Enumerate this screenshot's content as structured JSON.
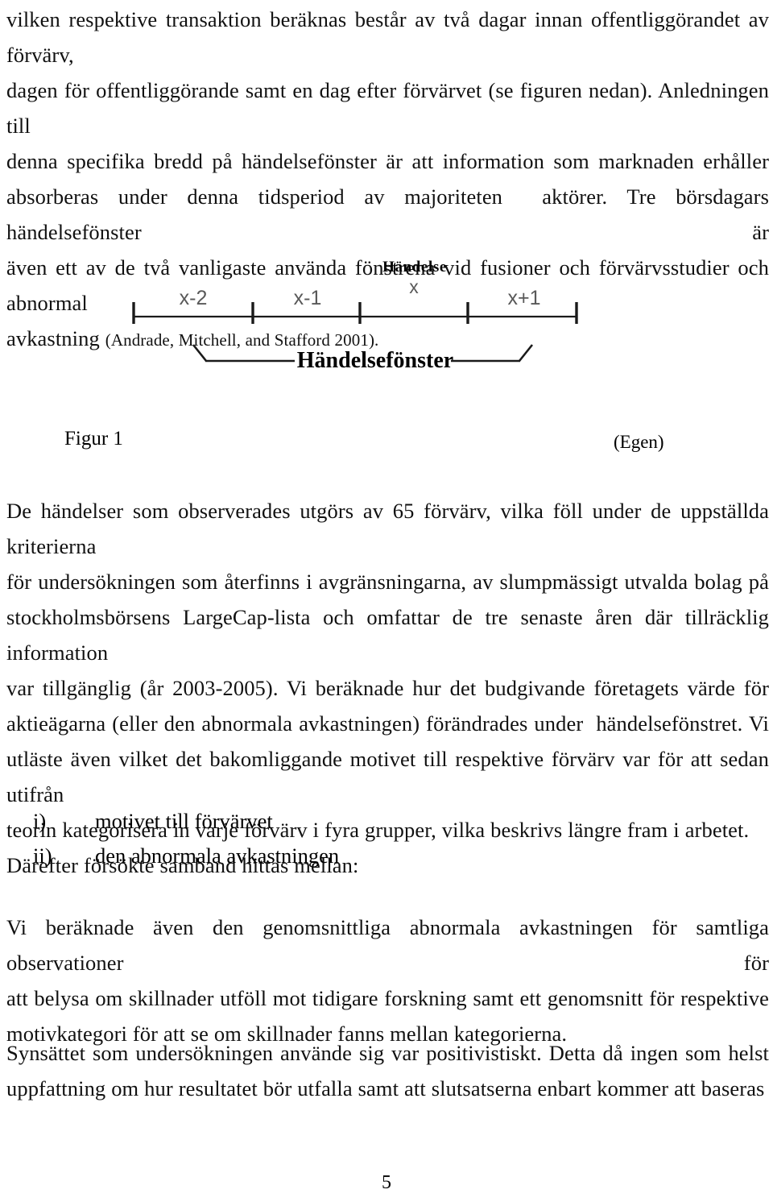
{
  "document": {
    "page_number": "5",
    "paragraph_1": {
      "lines": [
        "vilken respektive transaktion beräknas består av två dagar innan offentliggörandet av förvärv,",
        "dagen för offentliggörande samt en dag efter förvärvet (se figuren nedan). Anledningen till",
        "denna specifika bredd på händelsefönster är att information som marknaden erhåller",
        "absorberas under denna tidsperiod av majoriteten  aktörer. Tre börsdagars händelsefönster är",
        "även ett av de två vanligaste använda fönstrena vid fusioner och förvärvsstudier och abnormal",
        "avkastning "
      ],
      "citation": "(Andrade, Mitchell, and Stafford 2001)."
    },
    "figure": {
      "caption_label": "Figur 1",
      "caption_source": "(Egen)",
      "event_label": "Händelse",
      "event_tick_label": "x",
      "interval_labels": [
        "x-2",
        "x-1",
        "x+1"
      ],
      "window_label": "Händelsefönster",
      "tick_count": 5
    },
    "paragraph_2": {
      "lines": [
        "De händelser som observerades utgörs av 65 förvärv, vilka föll under de uppställda kriterierna",
        "för undersökningen som återfinns i avgränsningarna, av slumpmässigt utvalda bolag på",
        "stockholmsbörsens LargeCap-lista och omfattar de tre senaste åren där tillräcklig information",
        "var tillgänglig (år 2003-2005). Vi beräknade hur det budgivande företagets värde för",
        "aktieägarna (eller den abnormala avkastningen) förändrades under  händelsefönstret. Vi",
        "utläste även vilket det bakomliggande motivet till respektive förvärv var för att sedan utifrån",
        "teorin kategorisera in varje förvärv i fyra grupper, vilka beskrivs längre fram i arbetet.",
        "Därefter försökte samband hittas mellan:"
      ]
    },
    "list": {
      "items": [
        {
          "marker": "i)",
          "text": "motivet till förvärvet"
        },
        {
          "marker": "ii)",
          "text": "den abnormala avkastningen"
        }
      ]
    },
    "paragraph_3": {
      "lines": [
        "Vi beräknade även den genomsnittliga abnormala avkastningen för samtliga observationer för",
        "att belysa om skillnader utföll mot tidigare forskning samt ett genomsnitt för respektive",
        "motivkategori för att se om skillnader fanns mellan kategorierna."
      ]
    },
    "paragraph_4": {
      "lines": [
        "Synsättet som undersökningen använde sig var positivistiskt. Detta då ingen som helst",
        "uppfattning om hur resultatet bör utfalla samt att slutsatserna enbart kommer att baseras"
      ]
    },
    "colors": {
      "text": "#111111",
      "figure_line": "#1a1a1a",
      "figure_label": "#555555",
      "background": "#ffffff"
    }
  }
}
